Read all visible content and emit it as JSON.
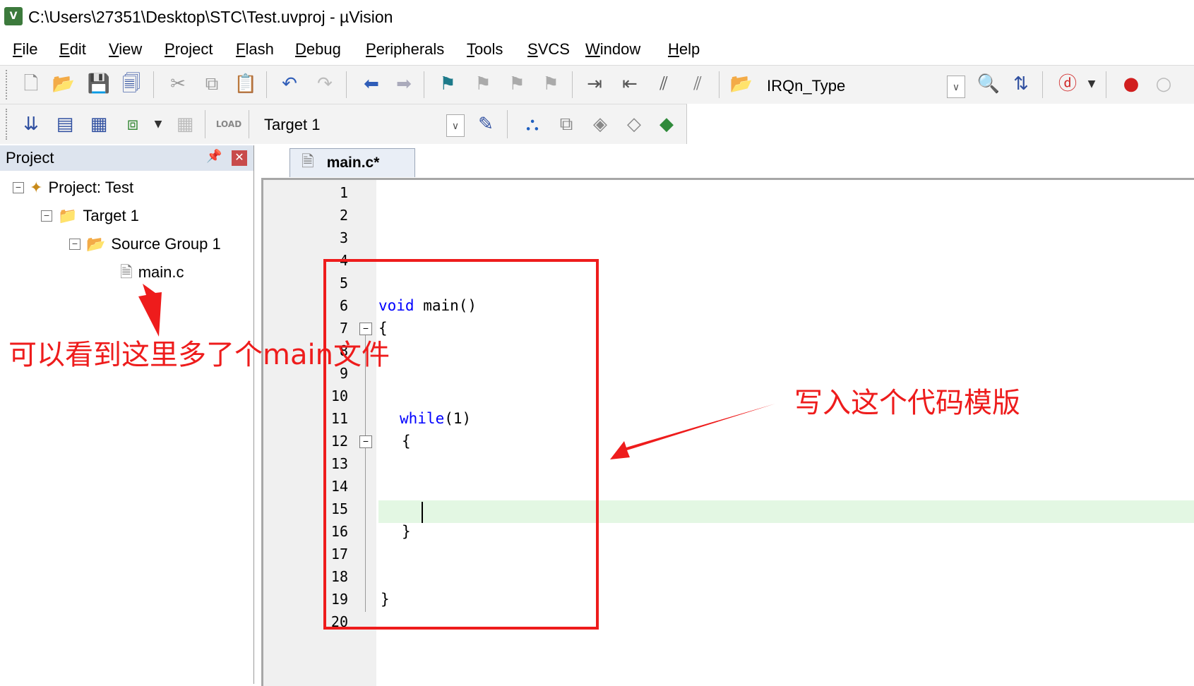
{
  "window": {
    "title": "C:\\Users\\27351\\Desktop\\STC\\Test.uvproj - µVision",
    "icon": "uvision-app-icon"
  },
  "menu": [
    "File",
    "Edit",
    "View",
    "Project",
    "Flash",
    "Debug",
    "Peripherals",
    "Tools",
    "SVCS",
    "Window",
    "Help"
  ],
  "toolbar": {
    "find_combo_value": "IRQn_Type",
    "target_combo_value": "Target 1"
  },
  "project_panel": {
    "title": "Project",
    "tree": {
      "project": "Project: Test",
      "target": "Target 1",
      "group": "Source Group 1",
      "file": "main.c"
    }
  },
  "editor": {
    "tab_label": "main.c*",
    "line_numbers": [
      "1",
      "2",
      "3",
      "4",
      "5",
      "6",
      "7",
      "8",
      "9",
      "10",
      "11",
      "12",
      "13",
      "14",
      "15",
      "16",
      "17",
      "18",
      "19",
      "20"
    ],
    "code": {
      "l6_kw": "void",
      "l6_rest": " main()",
      "l7": "{",
      "l11_kw": "while",
      "l11_rest": "(1)",
      "l12": "{",
      "l16": "}",
      "l19": "}"
    }
  },
  "annotations": {
    "left_note": "可以看到这里多了个main文件",
    "right_note": "写入这个代码模版",
    "color": "#ee1c1c"
  }
}
